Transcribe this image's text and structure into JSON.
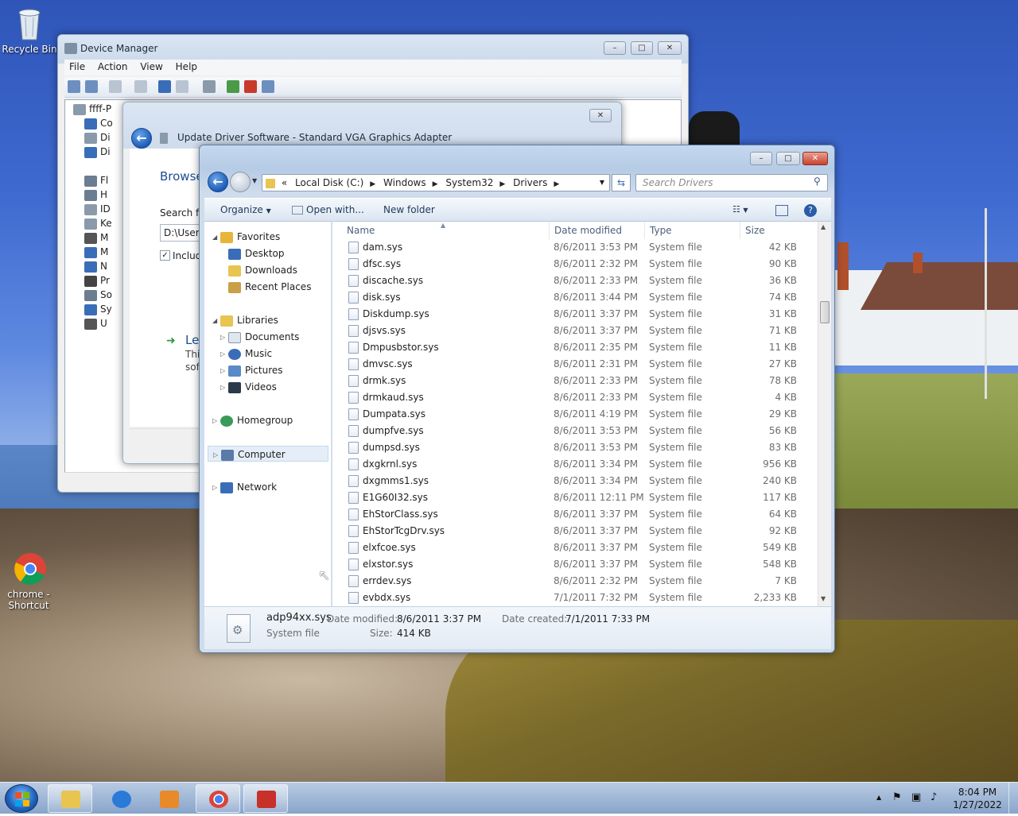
{
  "desktop": {
    "icons": [
      {
        "label": "Recycle Bin",
        "icon": "recycle-bin-icon"
      },
      {
        "label": "chrome - Shortcut",
        "icon": "chrome-icon"
      }
    ]
  },
  "device_manager": {
    "title": "Device Manager",
    "menu": [
      "File",
      "Action",
      "View",
      "Help"
    ],
    "tree_root": "ffff-P",
    "tree_items": [
      "Co",
      "Di",
      "Di",
      "Fl",
      "H",
      "ID",
      "Ke",
      "M",
      "M",
      "N",
      "Pr",
      "So",
      "Sy",
      "U"
    ]
  },
  "update_driver": {
    "title": "Update Driver Software - Standard VGA Graphics Adapter",
    "heading": "Browse",
    "search_label": "Search fo",
    "path_value": "D:\\Users",
    "include_label": "Includ",
    "link_heading": "Le",
    "link_text_1": "Thi",
    "link_text_2": "sof"
  },
  "explorer": {
    "breadcrumb": [
      "Local Disk (C:)",
      "Windows",
      "System32",
      "Drivers"
    ],
    "search_placeholder": "Search Drivers",
    "commands": {
      "organize": "Organize",
      "open_with": "Open with...",
      "new_folder": "New folder"
    },
    "nav": {
      "favorites": "Favorites",
      "favorites_items": [
        "Desktop",
        "Downloads",
        "Recent Places"
      ],
      "libraries": "Libraries",
      "libraries_items": [
        "Documents",
        "Music",
        "Pictures",
        "Videos"
      ],
      "homegroup": "Homegroup",
      "computer": "Computer",
      "network": "Network"
    },
    "columns": {
      "name": "Name",
      "date": "Date modified",
      "type": "Type",
      "size": "Size"
    },
    "files": [
      {
        "name": "dam.sys",
        "date": "8/6/2011 3:53 PM",
        "type": "System file",
        "size": "42 KB"
      },
      {
        "name": "dfsc.sys",
        "date": "8/6/2011 2:32 PM",
        "type": "System file",
        "size": "90 KB"
      },
      {
        "name": "discache.sys",
        "date": "8/6/2011 2:33 PM",
        "type": "System file",
        "size": "36 KB"
      },
      {
        "name": "disk.sys",
        "date": "8/6/2011 3:44 PM",
        "type": "System file",
        "size": "74 KB"
      },
      {
        "name": "Diskdump.sys",
        "date": "8/6/2011 3:37 PM",
        "type": "System file",
        "size": "31 KB"
      },
      {
        "name": "djsvs.sys",
        "date": "8/6/2011 3:37 PM",
        "type": "System file",
        "size": "71 KB"
      },
      {
        "name": "Dmpusbstor.sys",
        "date": "8/6/2011 2:35 PM",
        "type": "System file",
        "size": "11 KB"
      },
      {
        "name": "dmvsc.sys",
        "date": "8/6/2011 2:31 PM",
        "type": "System file",
        "size": "27 KB"
      },
      {
        "name": "drmk.sys",
        "date": "8/6/2011 2:33 PM",
        "type": "System file",
        "size": "78 KB"
      },
      {
        "name": "drmkaud.sys",
        "date": "8/6/2011 2:33 PM",
        "type": "System file",
        "size": "4 KB"
      },
      {
        "name": "Dumpata.sys",
        "date": "8/6/2011 4:19 PM",
        "type": "System file",
        "size": "29 KB"
      },
      {
        "name": "dumpfve.sys",
        "date": "8/6/2011 3:53 PM",
        "type": "System file",
        "size": "56 KB"
      },
      {
        "name": "dumpsd.sys",
        "date": "8/6/2011 3:53 PM",
        "type": "System file",
        "size": "83 KB"
      },
      {
        "name": "dxgkrnl.sys",
        "date": "8/6/2011 3:34 PM",
        "type": "System file",
        "size": "956 KB"
      },
      {
        "name": "dxgmms1.sys",
        "date": "8/6/2011 3:34 PM",
        "type": "System file",
        "size": "240 KB"
      },
      {
        "name": "E1G60I32.sys",
        "date": "8/6/2011 12:11 PM",
        "type": "System file",
        "size": "117 KB"
      },
      {
        "name": "EhStorClass.sys",
        "date": "8/6/2011 3:37 PM",
        "type": "System file",
        "size": "64 KB"
      },
      {
        "name": "EhStorTcgDrv.sys",
        "date": "8/6/2011 3:37 PM",
        "type": "System file",
        "size": "92 KB"
      },
      {
        "name": "elxfcoe.sys",
        "date": "8/6/2011 3:37 PM",
        "type": "System file",
        "size": "549 KB"
      },
      {
        "name": "elxstor.sys",
        "date": "8/6/2011 3:37 PM",
        "type": "System file",
        "size": "548 KB"
      },
      {
        "name": "errdev.sys",
        "date": "8/6/2011 2:32 PM",
        "type": "System file",
        "size": "7 KB"
      },
      {
        "name": "evbdx.sys",
        "date": "7/1/2011 7:32 PM",
        "type": "System file",
        "size": "2,233 KB"
      }
    ],
    "details": {
      "name": "adp94xx.sys",
      "type": "System file",
      "modified_label": "Date modified:",
      "modified": "8/6/2011 3:37 PM",
      "created_label": "Date created:",
      "created": "7/1/2011 7:33 PM",
      "size_label": "Size:",
      "size": "414 KB"
    }
  },
  "taskbar": {
    "time": "8:04 PM",
    "date": "1/27/2022"
  }
}
